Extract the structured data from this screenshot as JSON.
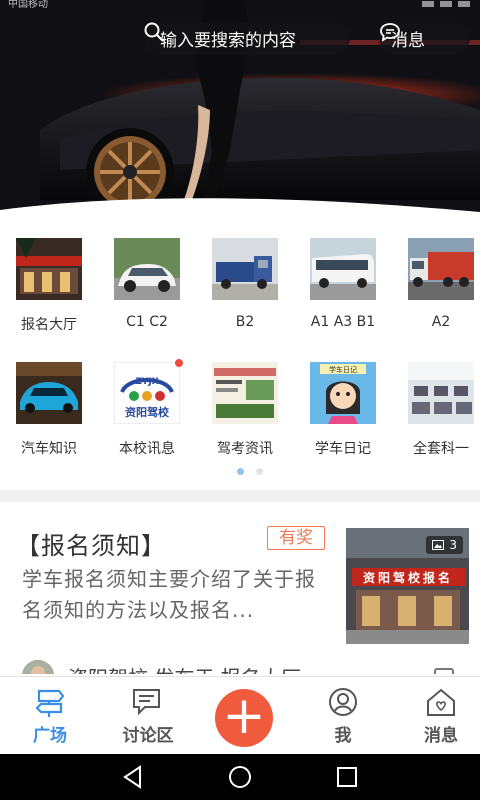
{
  "status_bar": {
    "carrier": "中国移动"
  },
  "header": {
    "search_placeholder": "输入要搜索的内容",
    "messages_label": "消息",
    "search_icon": "search-icon",
    "message_icon": "chat-bubble-icon"
  },
  "categories": [
    {
      "label": "报名大厅",
      "icon": "registration-hall-image"
    },
    {
      "label": "C1 C2",
      "icon": "sedan-image"
    },
    {
      "label": "B2",
      "icon": "truck-image"
    },
    {
      "label": "A1 A3 B1",
      "icon": "bus-image"
    },
    {
      "label": "A2",
      "icon": "semi-truck-image"
    },
    {
      "label": "汽车知识",
      "icon": "sports-car-image"
    },
    {
      "label": "本校讯息",
      "icon": "school-logo-image",
      "logo_text": "ZYJX",
      "logo_name": "资阳驾校",
      "has_dot": true
    },
    {
      "label": "驾考资讯",
      "icon": "exam-news-image"
    },
    {
      "label": "学车日记",
      "icon": "diary-image",
      "diary_text": "学车日记"
    },
    {
      "label": "全套科一",
      "icon": "exam-room-image"
    }
  ],
  "pager": {
    "pages": 2,
    "current": 1
  },
  "news": {
    "title": "【报名须知】",
    "badge": "有奖",
    "description": "学车报名须知主要介绍了关于报名须知的方法以及报名...",
    "image_count": "3",
    "author_line": "资阳驾校  发布于  报名大厅",
    "sign_text": "资阳驾校报名"
  },
  "tabs": [
    {
      "label": "广场",
      "icon": "plaza-signpost-icon",
      "active": true
    },
    {
      "label": "讨论区",
      "icon": "discussion-icon",
      "active": false
    },
    {
      "label": "我",
      "icon": "profile-icon",
      "active": false
    },
    {
      "label": "消息",
      "icon": "home-heart-icon",
      "active": false
    }
  ],
  "fab": {
    "label": "+"
  },
  "colors": {
    "accent": "#3a8ee6",
    "fab": "#f15b3d",
    "badge": "#f07b55"
  }
}
